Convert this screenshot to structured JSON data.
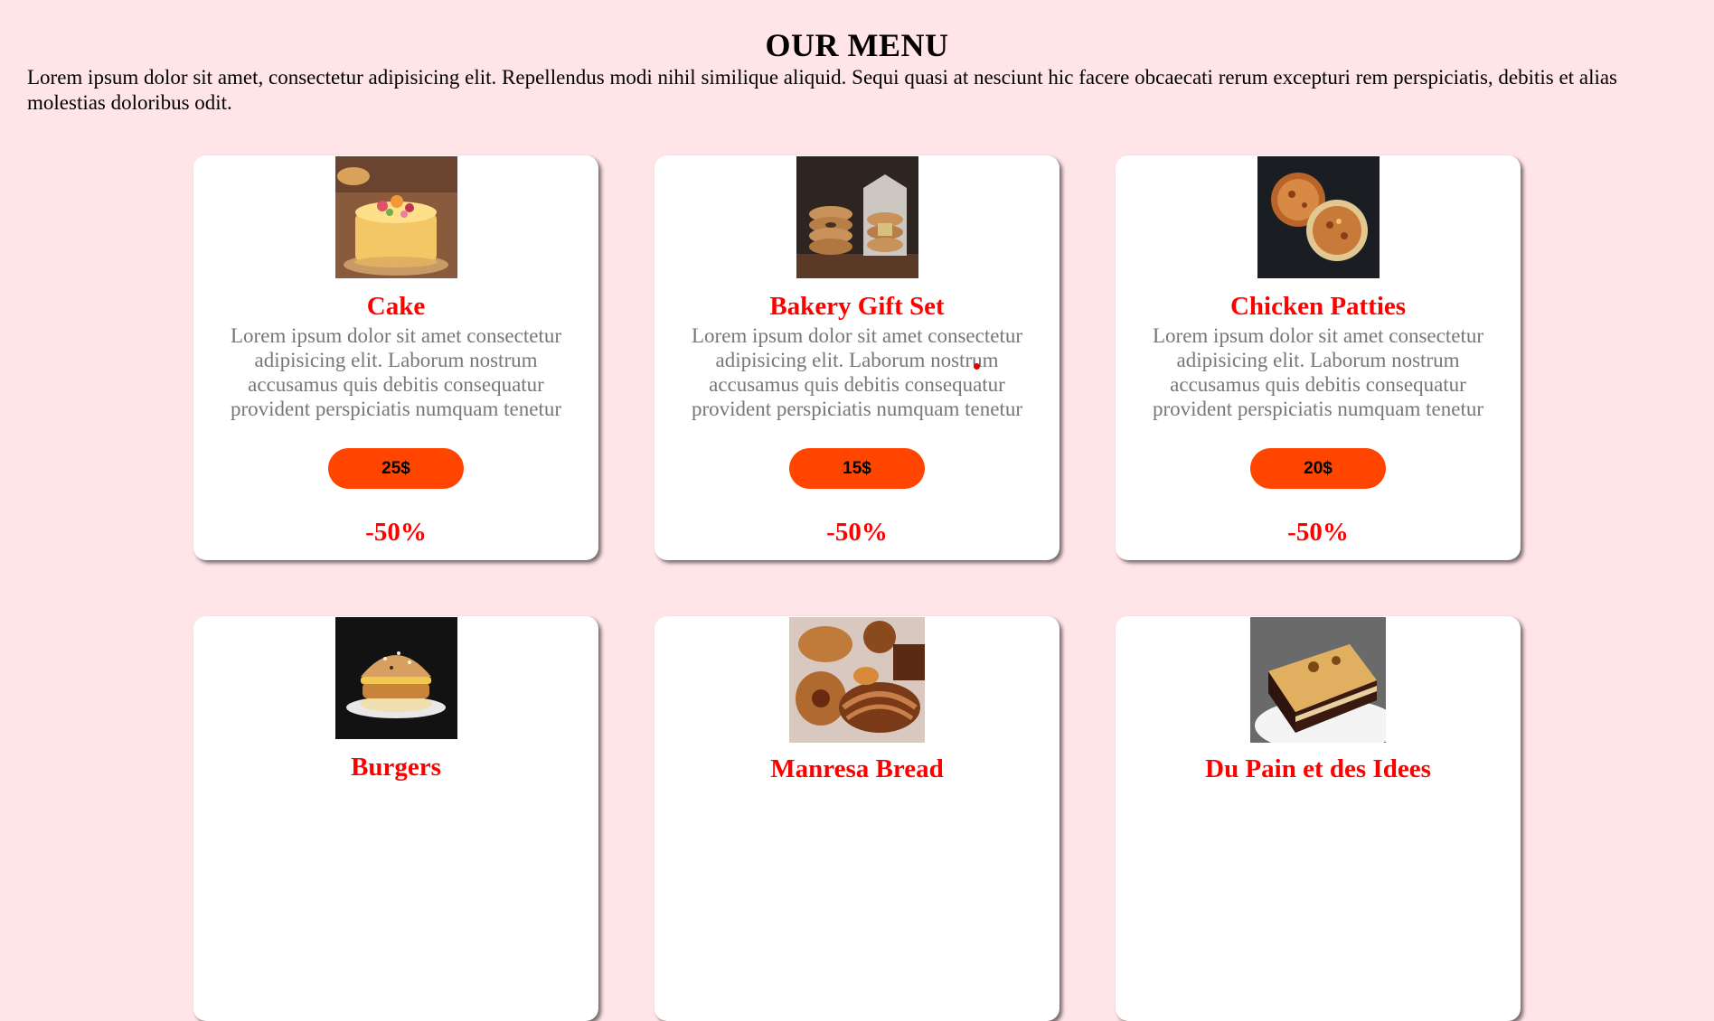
{
  "page": {
    "title": "OUR MENU",
    "intro": "Lorem ipsum dolor sit amet, consectetur adipisicing elit. Repellendus modi nihil similique aliquid. Sequi quasi at nesciunt hic facere obcaecati rerum excepturi rem perspiciatis, debitis et alias molestias doloribus odit."
  },
  "colors": {
    "background": "#ffe4e8",
    "dish_name": "#ff0000",
    "price_button": "#ff4500",
    "description": "#777777"
  },
  "menu": [
    {
      "name": "Cake",
      "description": "Lorem ipsum dolor sit amet consectetur adipisicing elit. Laborum nostrum accusamus quis debitis consequatur provident perspiciatis numquam tenetur",
      "price": "25$",
      "discount": "-50%",
      "image": "cake-photo"
    },
    {
      "name": "Bakery Gift Set",
      "description": "Lorem ipsum dolor sit amet consectetur adipisicing elit. Laborum nostrum accusamus quis debitis consequatur provident perspiciatis numquam tenetur",
      "price": "15$",
      "discount": "-50%",
      "image": "bagels-photo"
    },
    {
      "name": "Chicken Patties",
      "description": "Lorem ipsum dolor sit amet consectetur adipisicing elit. Laborum nostrum accusamus quis debitis consequatur provident perspiciatis numquam tenetur",
      "price": "20$",
      "discount": "-50%",
      "image": "patties-photo"
    },
    {
      "name": "Burgers",
      "image": "burger-photo"
    },
    {
      "name": "Manresa Bread",
      "image": "pastries-photo"
    },
    {
      "name": "Du Pain et des Idees",
      "image": "layer-cake-photo"
    }
  ]
}
